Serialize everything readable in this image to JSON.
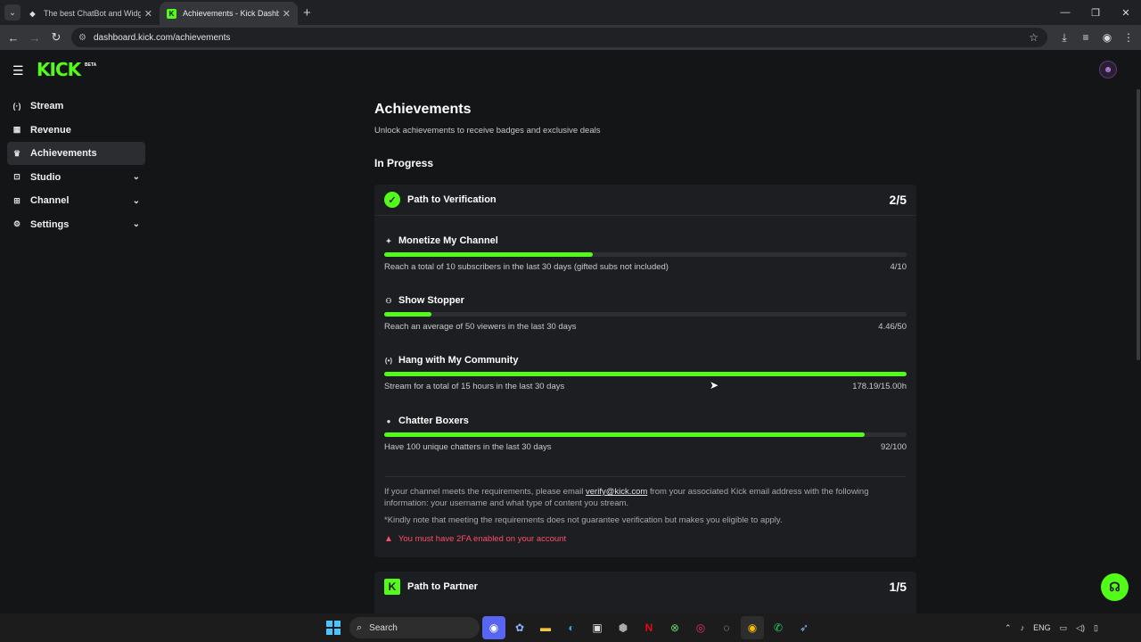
{
  "browser": {
    "tabs": [
      {
        "title": "The best ChatBot and Widgets",
        "icon": "diamond-icon"
      },
      {
        "title": "Achievements - Kick Dashboard",
        "icon": "kick-icon"
      }
    ],
    "url": "dashboard.kick.com/achievements"
  },
  "app": {
    "logo": "KICK",
    "beta": "BETA"
  },
  "sidebar": {
    "items": [
      {
        "label": "Stream",
        "icon": "stream-icon"
      },
      {
        "label": "Revenue",
        "icon": "revenue-icon"
      },
      {
        "label": "Achievements",
        "icon": "trophy-icon",
        "active": true
      },
      {
        "label": "Studio",
        "icon": "studio-icon",
        "expandable": true
      },
      {
        "label": "Channel",
        "icon": "channel-icon",
        "expandable": true
      },
      {
        "label": "Settings",
        "icon": "gear-icon",
        "expandable": true
      }
    ]
  },
  "main": {
    "title": "Achievements",
    "subtitle": "Unlock achievements to receive badges and exclusive deals",
    "section": "In Progress",
    "verification": {
      "title": "Path to Verification",
      "count": "2/5",
      "tasks": [
        {
          "title": "Monetize My Channel",
          "icon": "sparkle-icon",
          "desc": "Reach a total of 10 subscribers in the last 30 days (gifted subs not included)",
          "value": "4/10",
          "progress": 0.4
        },
        {
          "title": "Show Stopper",
          "icon": "viewers-icon",
          "desc": "Reach an average of 50 viewers in the last 30 days",
          "value": "4.46/50",
          "progress": 0.09
        },
        {
          "title": "Hang with My Community",
          "icon": "broadcast-icon",
          "desc": "Stream for a total of 15 hours in the last 30 days",
          "value": "178.19/15.00h",
          "progress": 1.0
        },
        {
          "title": "Chatter Boxers",
          "icon": "chat-icon",
          "desc": "Have 100 unique chatters in the last 30 days",
          "value": "92/100",
          "progress": 0.92
        }
      ],
      "note_prefix": "If your channel meets the requirements, please email ",
      "note_email": "verify@kick.com",
      "note_suffix": " from your associated Kick email address with the following information: your username and what type of content you stream.",
      "note2": "*Kindly note that meeting the requirements does not guarantee verification but makes you eligible to apply.",
      "warning": "You must have 2FA enabled on your account"
    },
    "partner": {
      "title": "Path to Partner",
      "count": "1/5"
    }
  },
  "taskbar": {
    "search": "Search",
    "lang": "ENG"
  },
  "colors": {
    "accent": "#53fc18",
    "warning": "#ff4d6a",
    "background": "#141517",
    "card": "#1d1e21"
  }
}
